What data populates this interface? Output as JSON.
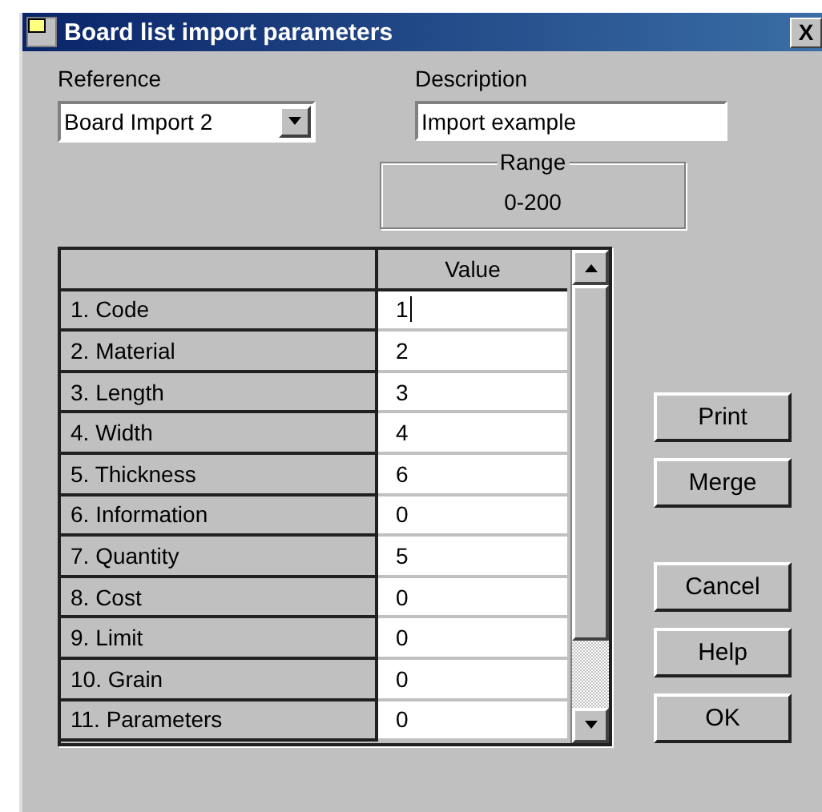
{
  "window": {
    "title": "Board list import parameters",
    "close": "X"
  },
  "reference": {
    "label": "Reference",
    "value": "Board Import 2"
  },
  "description": {
    "label": "Description",
    "value": "Import example"
  },
  "range": {
    "label": "Range",
    "value": "0-200"
  },
  "table": {
    "columns": [
      "Value"
    ],
    "rows": [
      {
        "name": "1. Code",
        "value": "1",
        "focused": true
      },
      {
        "name": "2. Material",
        "value": "2",
        "focused": false
      },
      {
        "name": "3. Length",
        "value": "3",
        "focused": false
      },
      {
        "name": "4. Width",
        "value": "4",
        "focused": false
      },
      {
        "name": "5. Thickness",
        "value": "6",
        "focused": false
      },
      {
        "name": "6. Information",
        "value": "0",
        "focused": false
      },
      {
        "name": "7. Quantity",
        "value": "5",
        "focused": false
      },
      {
        "name": "8. Cost",
        "value": "0",
        "focused": false
      },
      {
        "name": "9. Limit",
        "value": "0",
        "focused": false
      },
      {
        "name": "10. Grain",
        "value": "0",
        "focused": false
      },
      {
        "name": "11. Parameters",
        "value": "0",
        "focused": false
      }
    ]
  },
  "buttons": [
    {
      "label": "Print",
      "kind": "group1"
    },
    {
      "label": "Merge",
      "kind": "group1"
    },
    {
      "label": "Cancel",
      "kind": "group2"
    },
    {
      "label": "Help",
      "kind": "group2"
    },
    {
      "label": "OK",
      "kind": "group2"
    }
  ]
}
